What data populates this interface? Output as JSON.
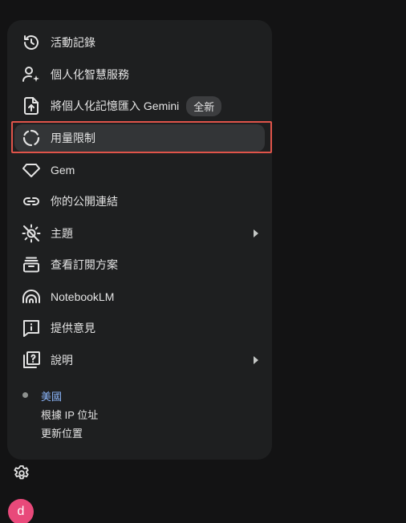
{
  "menu": {
    "items": [
      {
        "label": "活動記錄",
        "icon": "history-icon"
      },
      {
        "label": "個人化智慧服務",
        "icon": "person-sparkle-icon"
      },
      {
        "label": "將個人化記憶匯入 Gemini",
        "icon": "upload-file-icon",
        "badge": "全新"
      },
      {
        "label": "用量限制",
        "icon": "progress-circle-icon",
        "active": true
      },
      {
        "label": "Gem",
        "icon": "gem-icon"
      },
      {
        "label": "你的公開連結",
        "icon": "link-icon"
      },
      {
        "label": "主題",
        "icon": "theme-icon",
        "submenu": true
      },
      {
        "label": "查看訂閱方案",
        "icon": "subscription-icon"
      },
      {
        "label": "NotebookLM",
        "icon": "notebooklm-icon"
      },
      {
        "label": "提供意見",
        "icon": "feedback-icon"
      },
      {
        "label": "說明",
        "icon": "help-icon",
        "submenu": true
      }
    ]
  },
  "location": {
    "country": "美國",
    "source": "根據 IP 位址",
    "update_label": "更新位置"
  },
  "footer": {
    "settings_icon": "gear-icon",
    "avatar_letter": "d",
    "avatar_color": "#e8497a"
  },
  "colors": {
    "highlight_border": "#e0544a",
    "menu_bg": "#1e1f20",
    "page_bg": "#131314",
    "link": "#8ab4f8"
  }
}
